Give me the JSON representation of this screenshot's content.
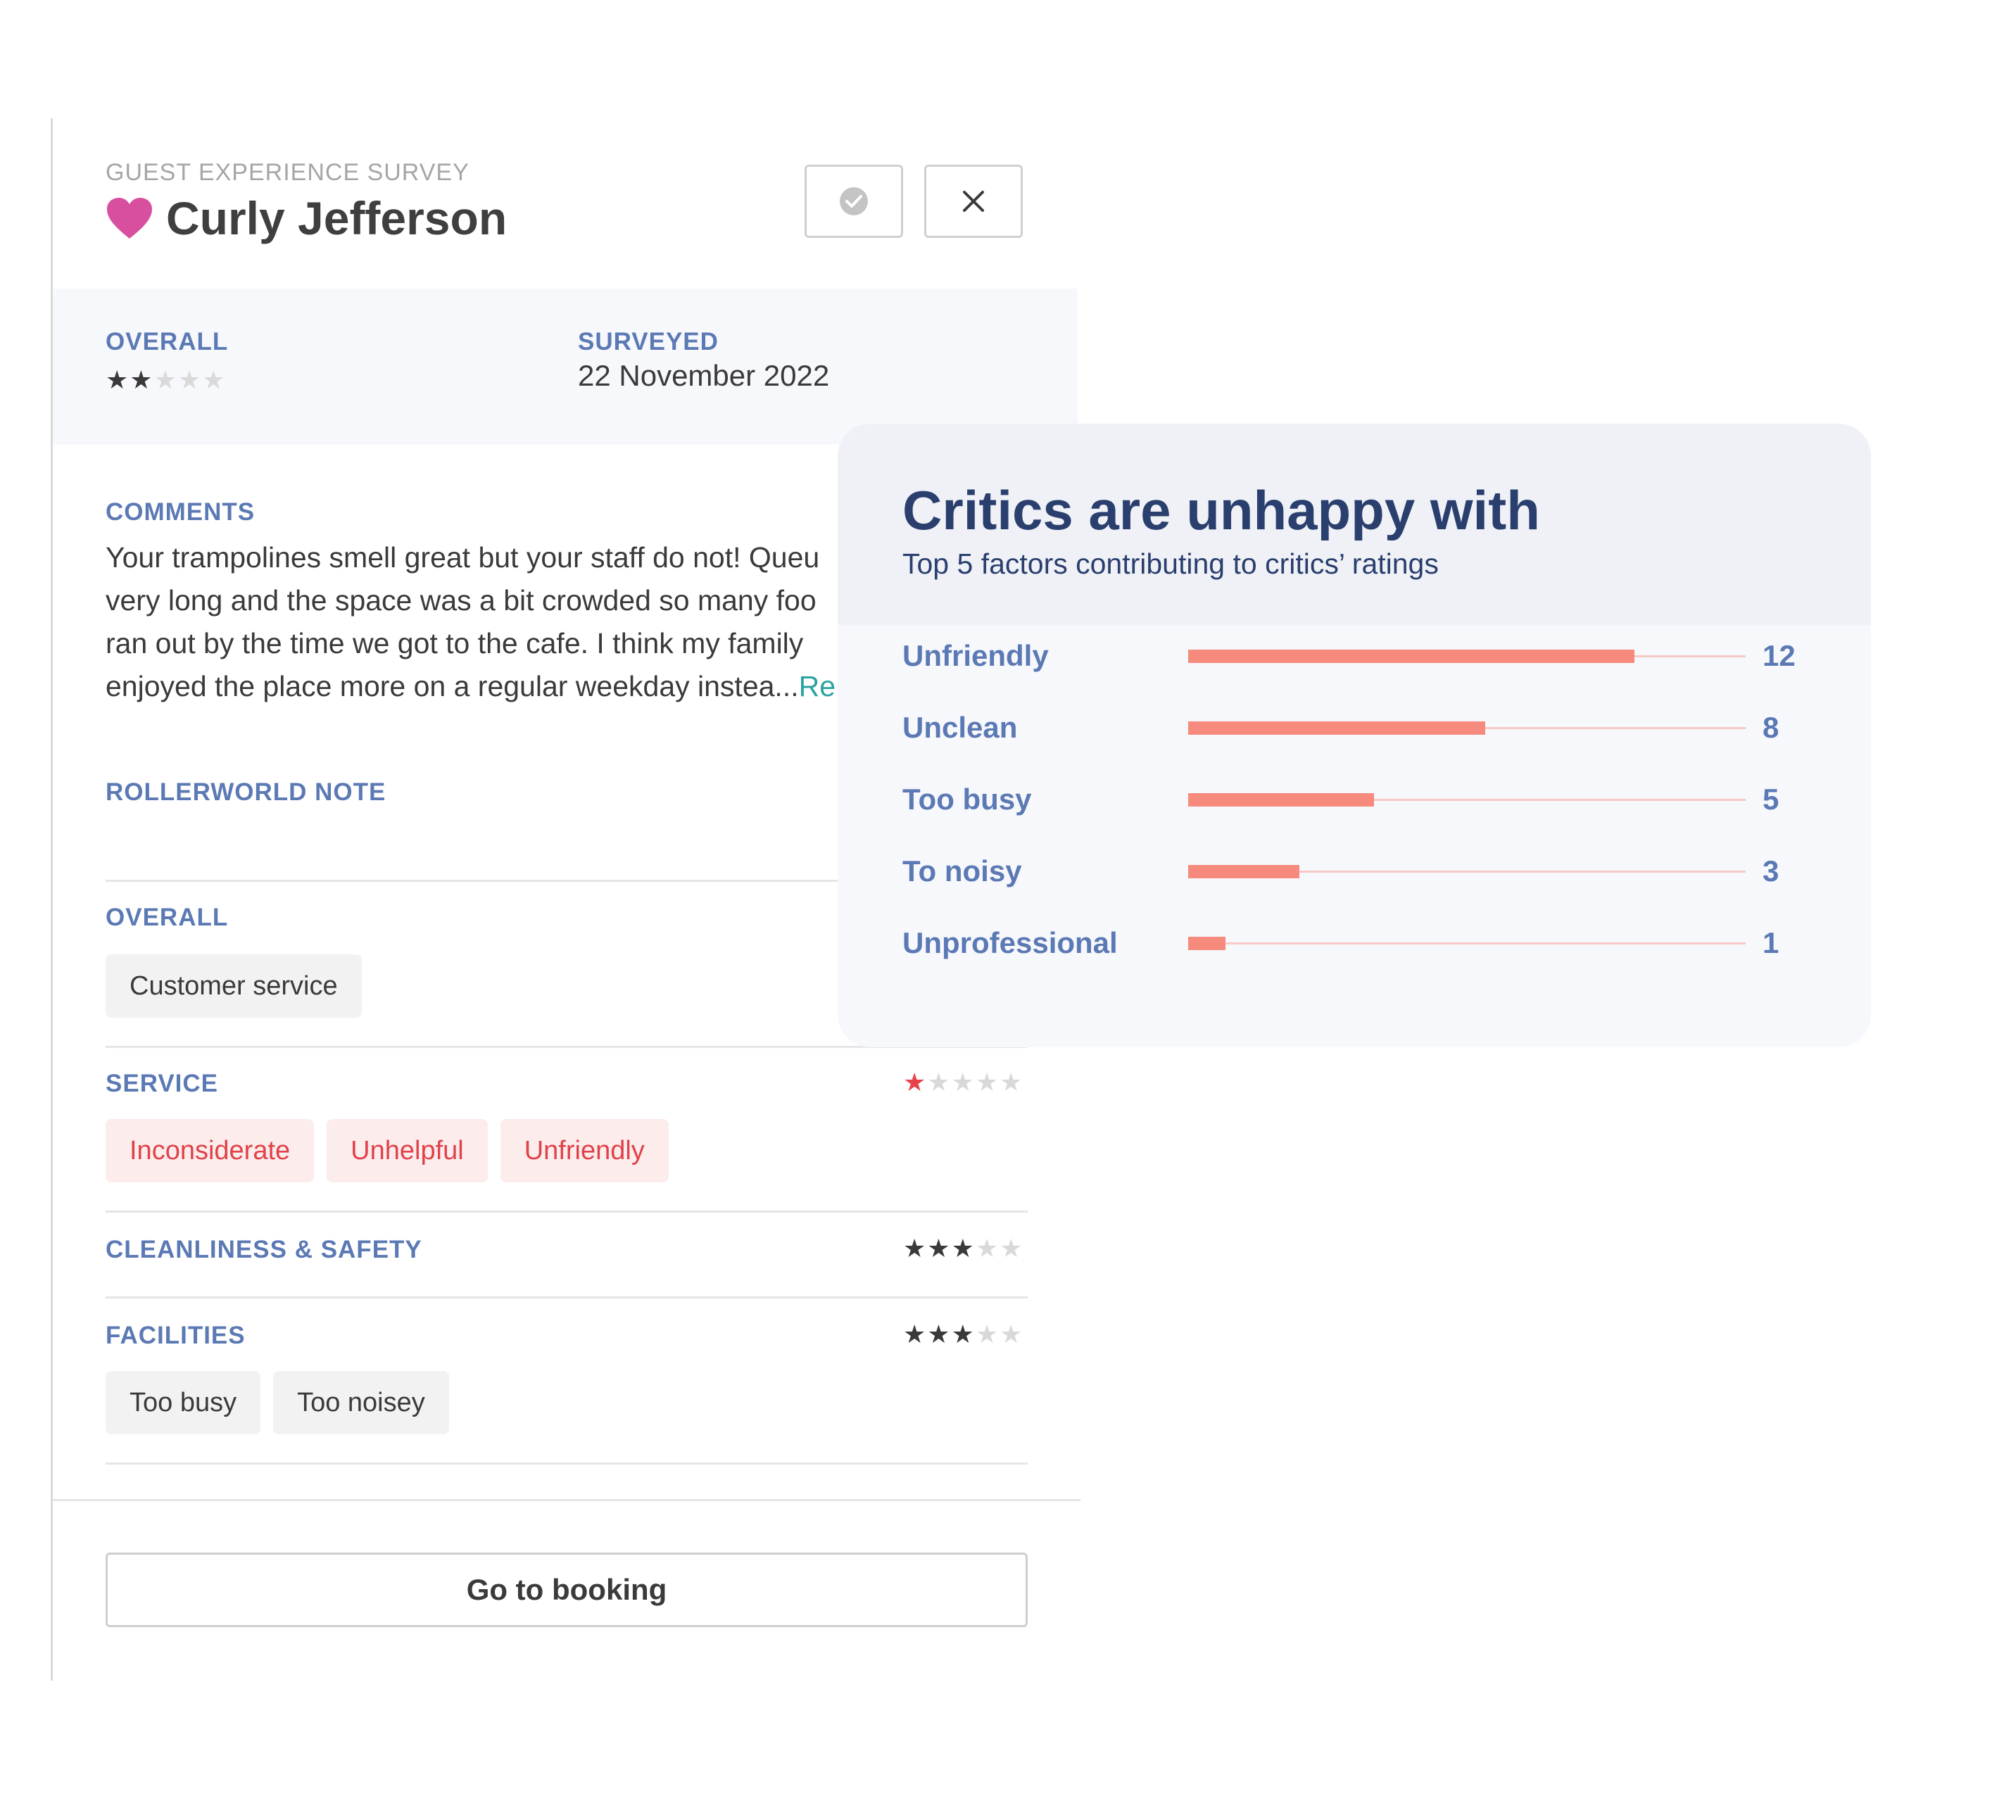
{
  "survey": {
    "eyebrow": "GUEST EXPERIENCE SURVEY",
    "guest_name": "Curly Jefferson",
    "icons": {
      "heart": "heart-icon",
      "approve": "check-circle-icon",
      "close": "close-icon"
    },
    "colors": {
      "heart": "#d94fa0",
      "accent": "#5b79b4",
      "bad": "#e0424a"
    }
  },
  "summary": {
    "overall_label": "OVERALL",
    "overall_rating": 2,
    "surveyed_label": "SURVEYED",
    "surveyed_date": "22 November 2022"
  },
  "comments": {
    "label": "COMMENTS",
    "lines": [
      "Your trampolines smell great but your staff do not! Queu",
      "very long and the space was a bit crowded so many foo",
      "ran out by the time we got to the cafe. I think my family",
      "enjoyed the place more on a regular weekday instea..."
    ],
    "read_more": "Re"
  },
  "note": {
    "label": "ROLLERWORLD NOTE"
  },
  "categories": [
    {
      "label": "OVERALL",
      "tags": [
        "Customer service"
      ],
      "tag_style": "neutral"
    },
    {
      "label": "SERVICE",
      "rating": 1,
      "tags": [
        "Inconsiderate",
        "Unhelpful",
        "Unfriendly"
      ],
      "tag_style": "bad"
    },
    {
      "label": "CLEANLINESS & SAFETY",
      "rating": 3
    },
    {
      "label": "FACILITIES",
      "rating": 3,
      "tags": [
        "Too busy",
        "Too noisey"
      ],
      "tag_style": "neutral"
    }
  ],
  "footer": {
    "booking_label": "Go to booking"
  },
  "critics": {
    "title": "Critics are unhappy with",
    "subtitle": "Top 5 factors contributing to critics’ ratings",
    "colors": {
      "bar": "#f68a7c",
      "track": "#f7c9c4",
      "label": "#5b79b4"
    },
    "chart_data": {
      "type": "bar",
      "orientation": "horizontal",
      "categories": [
        "Unfriendly",
        "Unclean",
        "Too busy",
        "To noisy",
        "Unprofessional"
      ],
      "values": [
        12,
        8,
        5,
        3,
        1
      ],
      "xlim": [
        0,
        15
      ],
      "grid": false
    }
  }
}
